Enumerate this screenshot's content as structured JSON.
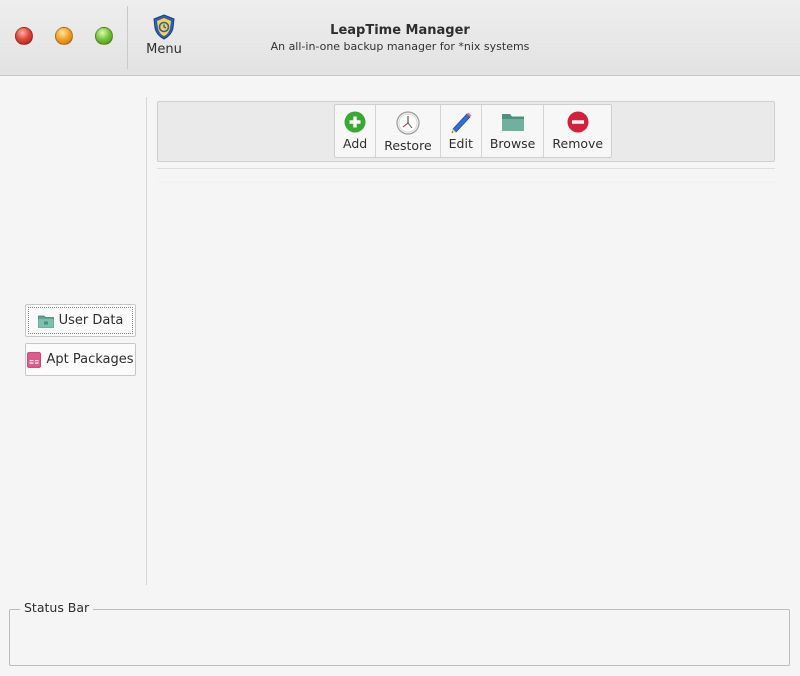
{
  "window": {
    "title": "LeapTime Manager",
    "subtitle": "An all-in-one backup manager for *nix systems",
    "menu_label": "Menu"
  },
  "toolbar": {
    "buttons": [
      {
        "label": "Add",
        "icon": "add-icon",
        "color": "#3aa832"
      },
      {
        "label": "Restore",
        "icon": "clock-icon",
        "color": "#d8d8d8"
      },
      {
        "label": "Edit",
        "icon": "pencil-icon",
        "color": "#2f6fd6"
      },
      {
        "label": "Browse",
        "icon": "folder-icon",
        "color": "#5aa593"
      },
      {
        "label": "Remove",
        "icon": "remove-icon",
        "color": "#d3203d"
      }
    ]
  },
  "sidebar": {
    "items": [
      {
        "label": "User Data",
        "icon": "folder-icon",
        "active": true
      },
      {
        "label": "Apt Packages",
        "icon": "package-icon",
        "active": false
      }
    ]
  },
  "status_bar": {
    "label": "Status Bar",
    "text": ""
  }
}
